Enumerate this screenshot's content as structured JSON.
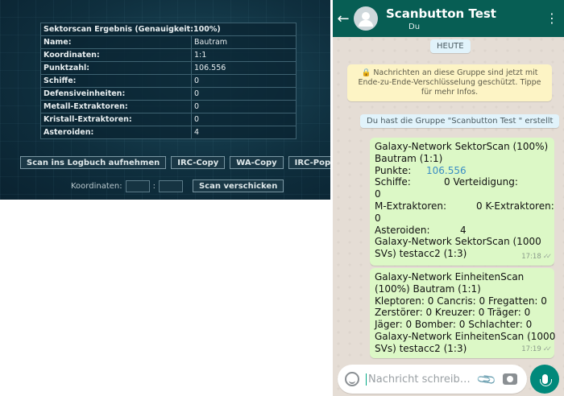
{
  "scan": {
    "title": "Sektorscan Ergebnis (Genauigkeit:100%)",
    "rows": [
      {
        "label": "Name:",
        "value": "Bautram"
      },
      {
        "label": "Koordinaten:",
        "value": "1:1"
      },
      {
        "label": "Punktzahl:",
        "value": "106.556"
      },
      {
        "label": "Schiffe:",
        "value": "0"
      },
      {
        "label": "Defensiveinheiten:",
        "value": "0"
      },
      {
        "label": "Metall-Extraktoren:",
        "value": "0"
      },
      {
        "label": "Kristall-Extraktoren:",
        "value": "0"
      },
      {
        "label": "Asteroiden:",
        "value": "4"
      }
    ],
    "buttons": {
      "logbook": "Scan ins Logbuch aufnehmen",
      "irc_copy": "IRC-Copy",
      "wa_copy": "WA-Copy",
      "irc_popup": "IRC-Popup"
    },
    "coords_label": "Koordinaten:",
    "coords_separator": ":",
    "send_button": "Scan verschicken"
  },
  "whatsapp": {
    "header": {
      "title": "Scanbutton Test",
      "subtitle": "Du"
    },
    "date_pill": "HEUTE",
    "encryption_notice": "🔒 Nachrichten an diese Gruppe sind jetzt mit Ende-zu-Ende-Verschlüsselung geschützt. Tippe für mehr Infos.",
    "created_pill": "Du hast die Gruppe \"Scanbutton Test \" erstellt",
    "message1": {
      "l1": "Galaxy-Network SektorScan (100%)",
      "l2": "Bautram   (1:1)",
      "l3_label": "Punkte:",
      "l3_value": "106.556",
      "l4a": "Schiffe:",
      "l4b": "0 Verteidigung:",
      "l5": "0",
      "l6a": "M-Extraktoren:",
      "l6b": "0 K-Extraktoren:",
      "l7": "0",
      "l8a": "Asteroiden:",
      "l8b": "4",
      "l9": "Galaxy-Network SektorScan (1000",
      "l10": "SVs) testacc2   (1:3)",
      "time": "17:18"
    },
    "message2": {
      "l1": "Galaxy-Network EinheitenScan",
      "l2": "(100%) Bautram (1:1)",
      "l3": "Kleptoren: 0 Cancris: 0 Fregatten: 0",
      "l4": "Zerstörer: 0 Kreuzer: 0 Träger: 0",
      "l5": "Jäger: 0 Bomber: 0 Schlachter: 0",
      "l6": "Galaxy-Network EinheitenScan (1000",
      "l7": "SVs) testacc2 (1:3)",
      "time": "17:19"
    },
    "input_placeholder": "Nachricht schreib…",
    "status_icon": "double-check-icon"
  },
  "colors": {
    "wa_header": "#075e54",
    "wa_bubble": "#dcf8c6",
    "wa_mic": "#00897b",
    "scan_bg": "#0f2f3e",
    "link": "#3a8dc4"
  }
}
